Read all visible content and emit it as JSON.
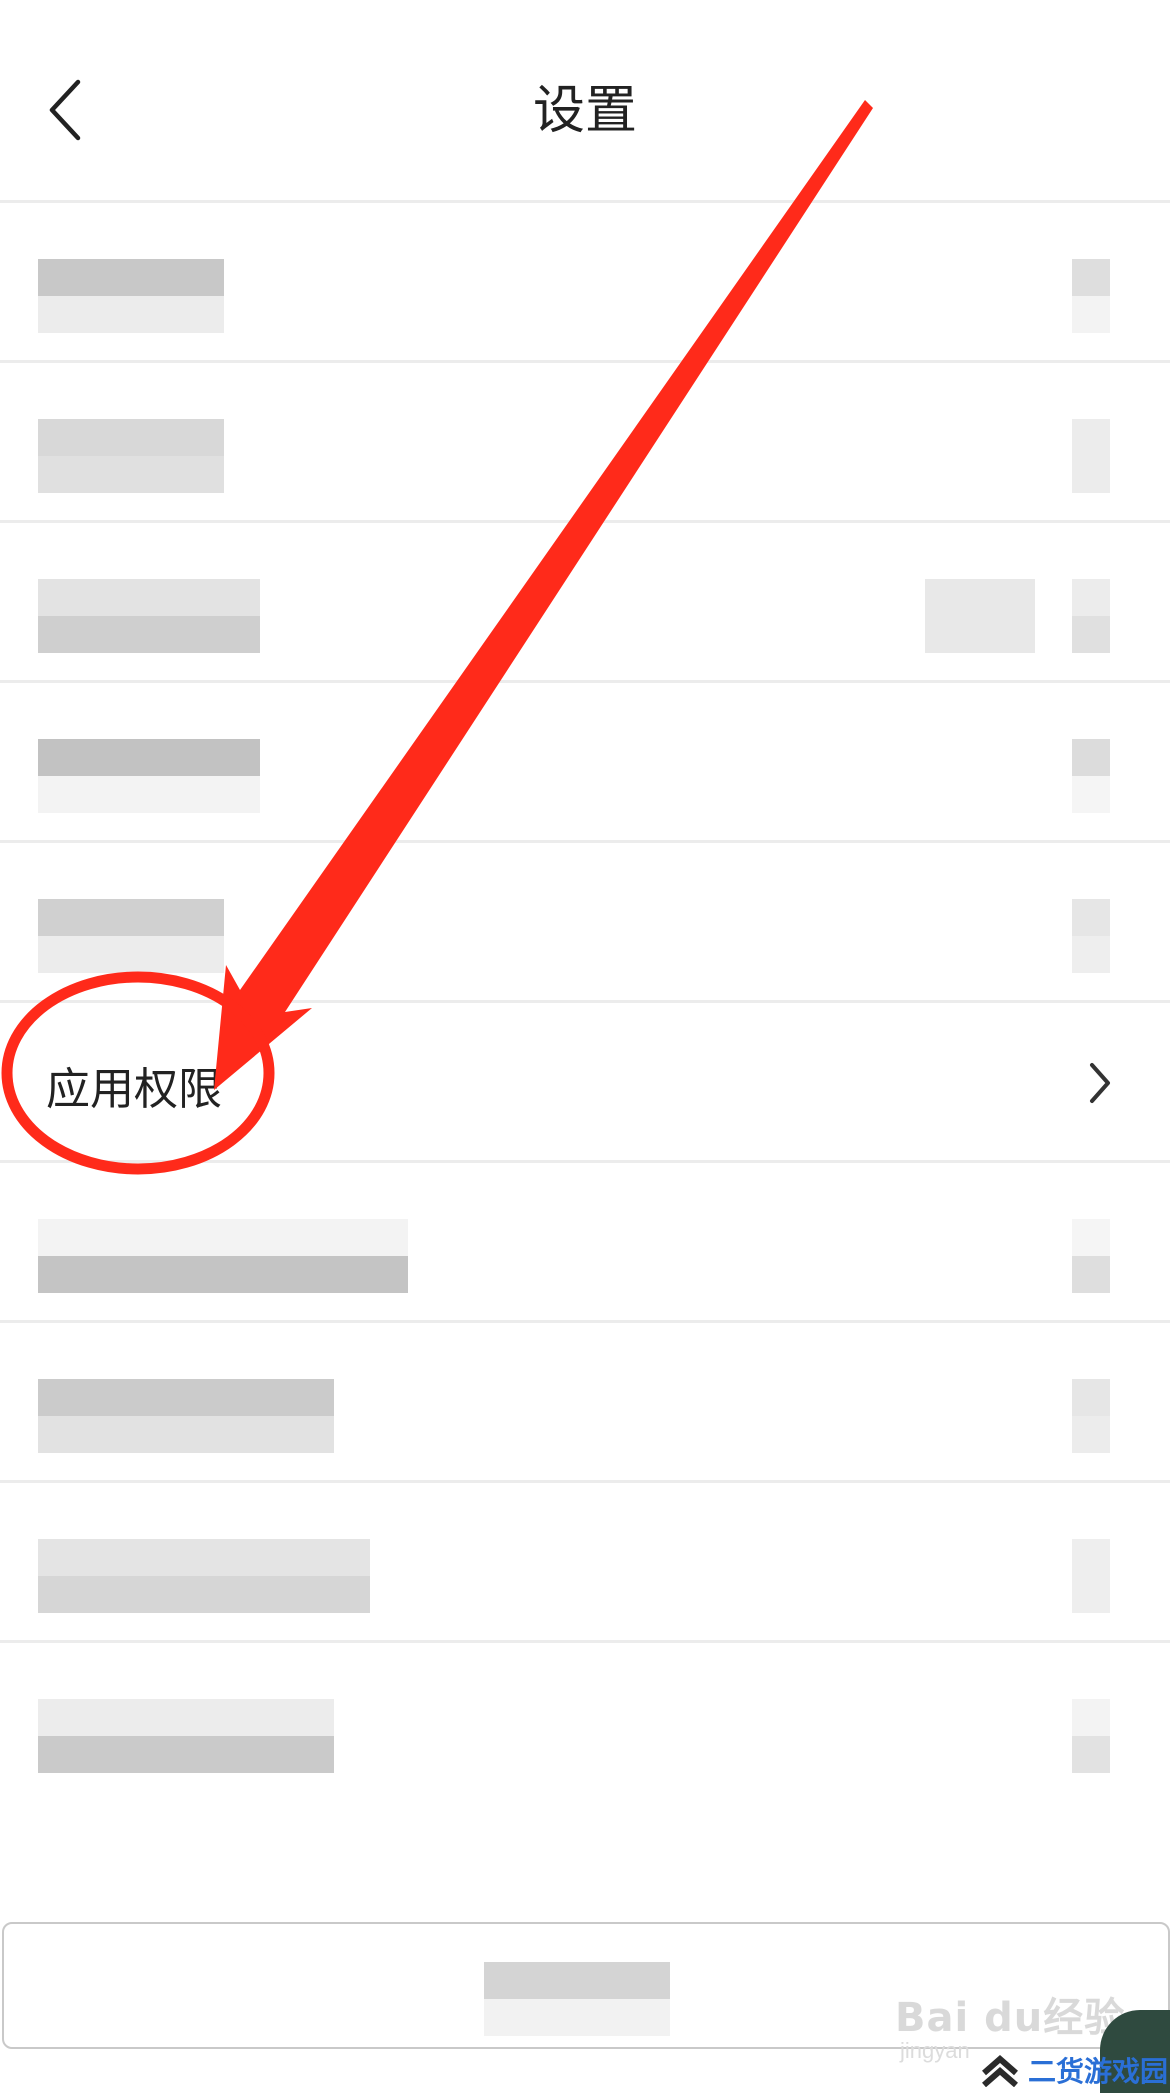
{
  "header": {
    "title": "设置",
    "back_icon": "chevron-left-icon"
  },
  "list": {
    "items": [
      {
        "label": "",
        "blurred": true
      },
      {
        "label": "",
        "blurred": true
      },
      {
        "label": "",
        "blurred": true
      },
      {
        "label": "",
        "blurred": true
      },
      {
        "label": "",
        "blurred": true
      },
      {
        "label": "应用权限",
        "blurred": false,
        "icon": "chevron-right-icon"
      },
      {
        "label": "",
        "blurred": true
      },
      {
        "label": "",
        "blurred": true
      },
      {
        "label": "",
        "blurred": true
      },
      {
        "label": "",
        "blurred": true
      }
    ]
  },
  "bottom_button": {
    "label": "",
    "blurred": true
  },
  "annotation": {
    "color": "#ff2a1a",
    "shapes": [
      "arrow",
      "ellipse"
    ]
  },
  "watermark": {
    "baidu": "Bai du经验",
    "jingyan": "jingyan",
    "site": "二货游戏园",
    "site_color": "#2a6fd6"
  }
}
